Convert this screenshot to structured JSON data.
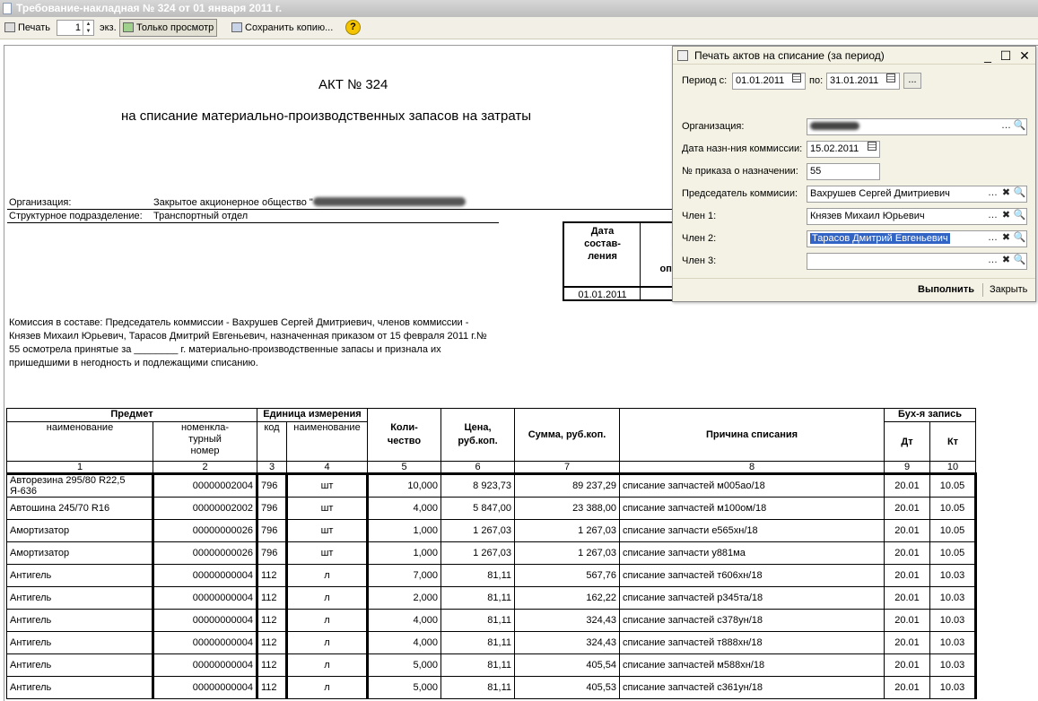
{
  "window": {
    "title": "Требование-накладная № 324 от 01 января 2011 г."
  },
  "toolbar": {
    "print_label": "Печать",
    "copies_value": "1",
    "copies_unit": "экз.",
    "view_only_label": "Только просмотр",
    "save_copy_label": "Сохранить копию...",
    "help_label": "?"
  },
  "document": {
    "title": "АКТ № 324",
    "subtitle": "на списание материально-производственных запасов на затраты",
    "org_label": "Организация:",
    "org_value": "Закрытое акционерное общество \"",
    "dept_label": "Структурное подразделение:",
    "dept_value": "Транспортный отдел",
    "date_header": "Дата\nсостав-\nления",
    "date_header_cut": "К\nв\nопе",
    "date_value": "01.01.2011",
    "commission_text": "Комиссия в составе: Председатель коммиссии - Вахрушев Сергей Дмитриевич, членов коммиссии - Князев Михаил Юрьевич, Тарасов Дмитрий Евгеньевич, назначенная приказом от 15 февраля 2011 г.№ 55 осмотрела принятые за ________ г. материально-производственные запасы и признала их пришедшими в негодность и подлежащими списанию."
  },
  "table": {
    "group_headers": {
      "item": "Предмет",
      "unit": "Единица измерения",
      "account": "Бух-я запись"
    },
    "headers": {
      "name": "наименование",
      "nomen": "номенкла-\nтурный\nномер",
      "code": "код",
      "unit_name": "наименование",
      "qty": "Коли-\nчество",
      "price": "Цена,\nруб.коп.",
      "sum": "Сумма, руб.коп.",
      "reason": "Причина списания",
      "dt": "Дт",
      "kt": "Кт"
    },
    "col_numbers": [
      "1",
      "2",
      "3",
      "4",
      "5",
      "6",
      "7",
      "8",
      "9",
      "10"
    ],
    "rows": [
      {
        "name": "Авторезина 295/80 R22,5 Я-636",
        "nomen": "00000002004",
        "code": "796",
        "unit": "шт",
        "qty": "10,000",
        "price": "8 923,73",
        "sum": "89 237,29",
        "reason": "списание запчастей м005ао/18",
        "dt": "20.01",
        "kt": "10.05"
      },
      {
        "name": "Автошина 245/70 R16",
        "nomen": "00000002002",
        "code": "796",
        "unit": "шт",
        "qty": "4,000",
        "price": "5 847,00",
        "sum": "23 388,00",
        "reason": "списание запчастей м100ом/18",
        "dt": "20.01",
        "kt": "10.05"
      },
      {
        "name": "Амортизатор",
        "nomen": "00000000026",
        "code": "796",
        "unit": "шт",
        "qty": "1,000",
        "price": "1 267,03",
        "sum": "1 267,03",
        "reason": "списание запчасти е565хн/18",
        "dt": "20.01",
        "kt": "10.05"
      },
      {
        "name": "Амортизатор",
        "nomen": "00000000026",
        "code": "796",
        "unit": "шт",
        "qty": "1,000",
        "price": "1 267,03",
        "sum": "1 267,03",
        "reason": "списание запчасти у881ма",
        "dt": "20.01",
        "kt": "10.05"
      },
      {
        "name": "Антигель",
        "nomen": "00000000004",
        "code": "112",
        "unit": "л",
        "qty": "7,000",
        "price": "81,11",
        "sum": "567,76",
        "reason": "списание запчастей т606хн/18",
        "dt": "20.01",
        "kt": "10.03"
      },
      {
        "name": "Антигель",
        "nomen": "00000000004",
        "code": "112",
        "unit": "л",
        "qty": "2,000",
        "price": "81,11",
        "sum": "162,22",
        "reason": "списание запчастей р345та/18",
        "dt": "20.01",
        "kt": "10.03"
      },
      {
        "name": "Антигель",
        "nomen": "00000000004",
        "code": "112",
        "unit": "л",
        "qty": "4,000",
        "price": "81,11",
        "sum": "324,43",
        "reason": "списание запчастей с378ун/18",
        "dt": "20.01",
        "kt": "10.03"
      },
      {
        "name": "Антигель",
        "nomen": "00000000004",
        "code": "112",
        "unit": "л",
        "qty": "4,000",
        "price": "81,11",
        "sum": "324,43",
        "reason": "списание запчастей т888хн/18",
        "dt": "20.01",
        "kt": "10.03"
      },
      {
        "name": "Антигель",
        "nomen": "00000000004",
        "code": "112",
        "unit": "л",
        "qty": "5,000",
        "price": "81,11",
        "sum": "405,54",
        "reason": "списание запчастей м588хн/18",
        "dt": "20.01",
        "kt": "10.03"
      },
      {
        "name": "Антигель",
        "nomen": "00000000004",
        "code": "112",
        "unit": "л",
        "qty": "5,000",
        "price": "81,11",
        "sum": "405,53",
        "reason": "списание запчастей с361ун/18",
        "dt": "20.01",
        "kt": "10.03"
      }
    ]
  },
  "dialog": {
    "title": "Печать актов на списание (за период)",
    "period_from_label": "Период с:",
    "period_from": "01.01.2011",
    "period_to_label": "по:",
    "period_to": "31.01.2011",
    "ellipsis": "...",
    "org_label": "Организация:",
    "commission_date_label": "Дата назн-ния коммиссии:",
    "commission_date": "15.02.2011",
    "order_label": "№ приказа о назначении:",
    "order_value": "55",
    "chair_label": "Председатель коммисии:",
    "chair_value": "Вахрушев Сергей Дмитриевич",
    "member1_label": "Член 1:",
    "member1_value": "Князев Михаил Юрьевич",
    "member2_label": "Член 2:",
    "member2_value": "Тарасов Дмитрий Евгеньевич",
    "member3_label": "Член 3:",
    "member3_value": "",
    "run_label": "Выполнить",
    "close_label": "Закрыть"
  }
}
